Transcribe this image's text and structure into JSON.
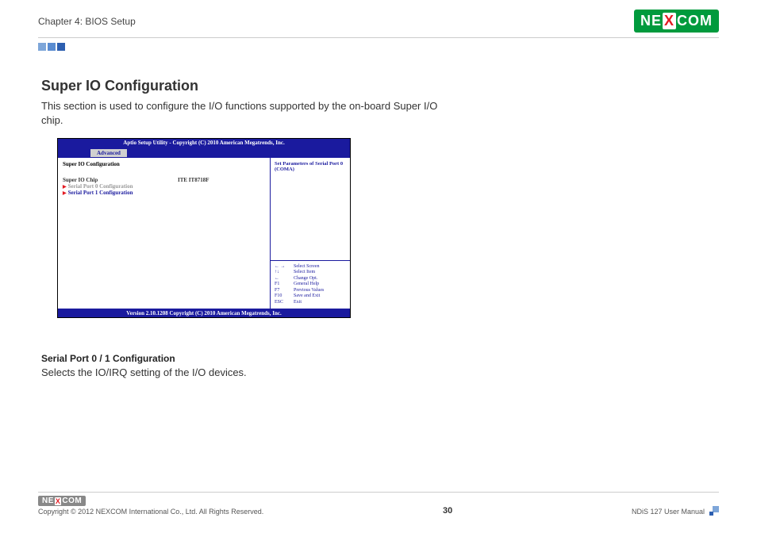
{
  "header": {
    "chapter": "Chapter 4: BIOS Setup",
    "logo_text_1": "NE",
    "logo_x": "X",
    "logo_text_2": "COM"
  },
  "main": {
    "title": "Super IO Configuration",
    "intro": "This section is used to configure the I/O functions supported by the on-board Super I/O chip."
  },
  "bios": {
    "title": "Aptio  Setup  Utility - Copyright (C) 2010 American Megatrends, Inc.",
    "tab": "Advanced",
    "section_title": "Super IO Configuration",
    "chip_label": "Super IO Chip",
    "chip_value": "ITE IT8718F",
    "link0": "Serial Port 0 Configuration",
    "link1": "Serial Port 1 Configuration",
    "help_text": "Set Parameters of Serial Port 0 (COMA)",
    "keys": [
      {
        "k": "← →",
        "d": "Select Screen"
      },
      {
        "k": "↑↓",
        "d": "Select Item"
      },
      {
        "k": "←",
        "d": "Change Opt."
      },
      {
        "k": "F1",
        "d": "General Help"
      },
      {
        "k": "F7",
        "d": "Previous Values"
      },
      {
        "k": "F10",
        "d": "Save and Exit"
      },
      {
        "k": "ESC",
        "d": "Exit"
      }
    ],
    "footer": "Version 2.10.1208 Copyright (C) 2010 American Megatrends, Inc."
  },
  "subsection": {
    "title": "Serial Port 0 / 1 Configuration",
    "desc": "Selects the IO/IRQ setting of the I/O devices."
  },
  "footer": {
    "copyright": "Copyright © 2012 NEXCOM International Co., Ltd. All Rights Reserved.",
    "page": "30",
    "manual": "NDiS 127 User Manual"
  }
}
